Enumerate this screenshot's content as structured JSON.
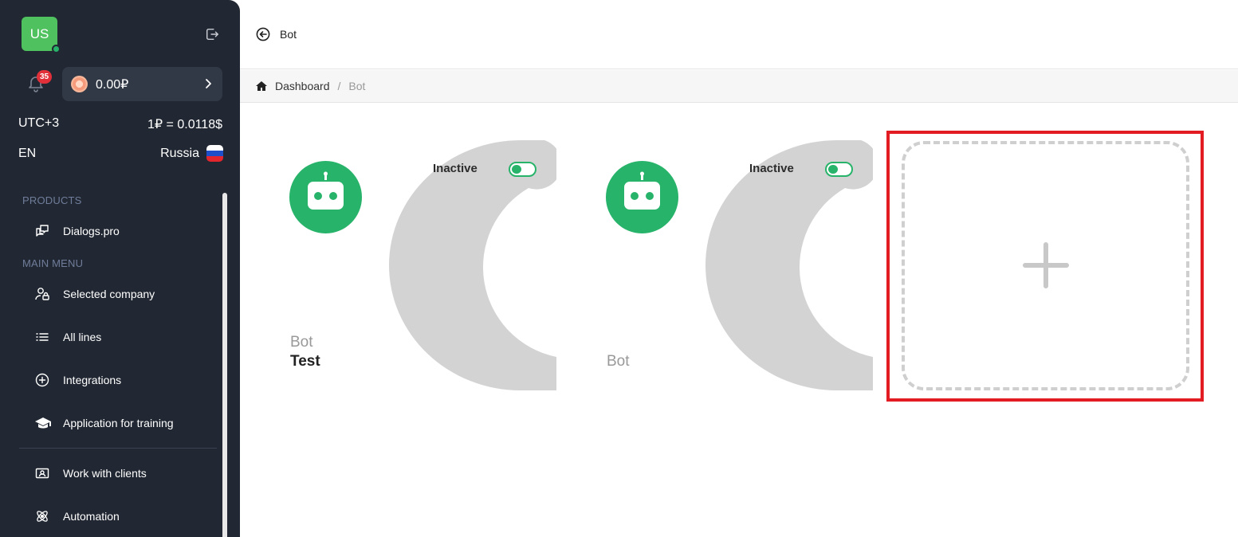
{
  "user": {
    "initials": "US"
  },
  "notifications": {
    "count": "35"
  },
  "balance": {
    "amount": "0.00₽"
  },
  "timezone": "UTC+3",
  "rate": "1₽ = 0.0118$",
  "language": "EN",
  "country": "Russia",
  "sidebar": {
    "products_label": "PRODUCTS",
    "products": [
      {
        "label": "Dialogs.pro",
        "icon": "chat-icon"
      }
    ],
    "main_menu_label": "MAIN MENU",
    "main_menu": [
      {
        "label": "Selected company",
        "icon": "user-lock-icon"
      },
      {
        "label": "All lines",
        "icon": "list-icon"
      },
      {
        "label": "Integrations",
        "icon": "plus-circle-icon"
      },
      {
        "label": "Application for training",
        "icon": "graduation-cap-icon"
      }
    ],
    "secondary_menu": [
      {
        "label": "Work with clients",
        "icon": "contact-card-icon"
      },
      {
        "label": "Automation",
        "icon": "atom-icon"
      }
    ]
  },
  "header": {
    "title": "Bot"
  },
  "breadcrumb": {
    "home": "Dashboard",
    "separator": "/",
    "current": "Bot"
  },
  "bots": [
    {
      "status": "Inactive",
      "name_line1": "Bot",
      "name_line2": "Test"
    },
    {
      "status": "Inactive",
      "name_line1": "",
      "name_line2": "Bot"
    }
  ],
  "colors": {
    "accent": "#27b36a",
    "sidebar_bg": "#222833",
    "highlight": "#e31c23",
    "avatar": "#4fc25f"
  }
}
